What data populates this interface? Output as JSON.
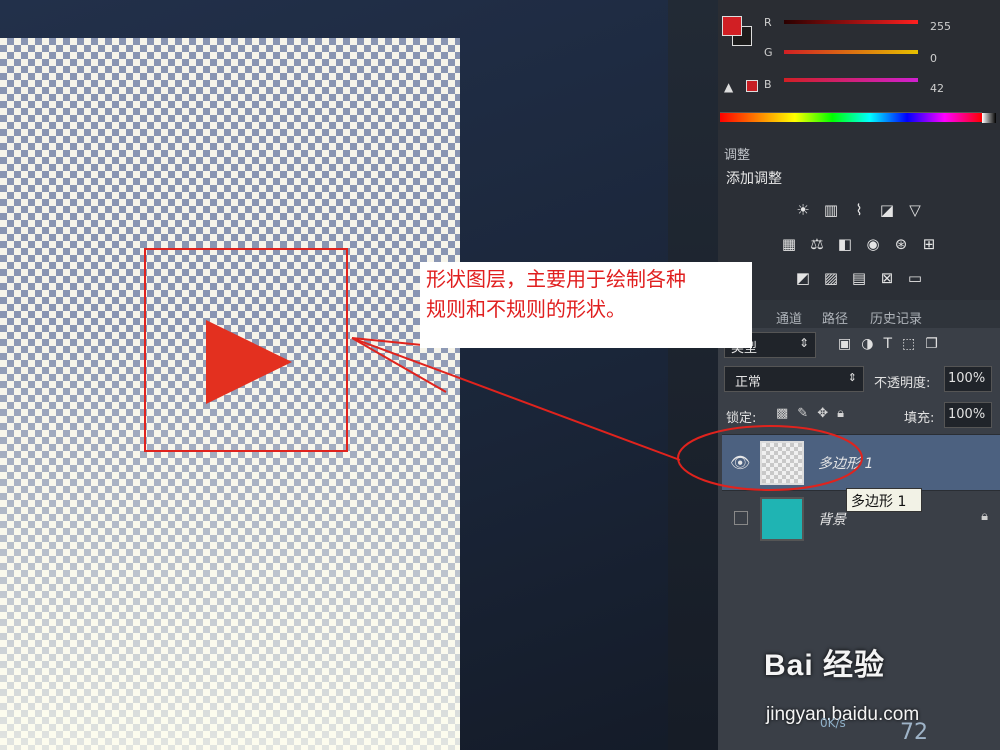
{
  "annotation": {
    "line1": "形状图层，主要用于绘制各种",
    "line2": "规则和不规则的形状。"
  },
  "color_panel": {
    "fg_color": "#d11f24",
    "channels": [
      {
        "label": "R",
        "value": "255"
      },
      {
        "label": "G",
        "value": "0"
      },
      {
        "label": "B",
        "value": "42"
      }
    ]
  },
  "adjustments": {
    "tab": "调整",
    "title": "添加调整"
  },
  "layers": {
    "tabs": [
      "通道",
      "路径",
      "历史记录"
    ],
    "filter_value": "类型",
    "blend_mode": "正常",
    "opacity_label": "不透明度:",
    "opacity_value": "100%",
    "lock_label": "锁定:",
    "fill_label": "填充:",
    "fill_value": "100%",
    "items": [
      {
        "name": "多边形 1",
        "selected": true
      },
      {
        "name": "背景",
        "selected": false
      }
    ],
    "tooltip": "多边形 1"
  },
  "watermark": {
    "logo": "Bai 经验",
    "url": "jingyan.baidu.com"
  },
  "status": {
    "speed": "0K/s",
    "number": "72"
  },
  "colors": {
    "shape_red": "#e3301f",
    "annotation_red": "#e01f1f",
    "teal_layer": "#1fb4b3",
    "selected_row": "#4c6180"
  }
}
